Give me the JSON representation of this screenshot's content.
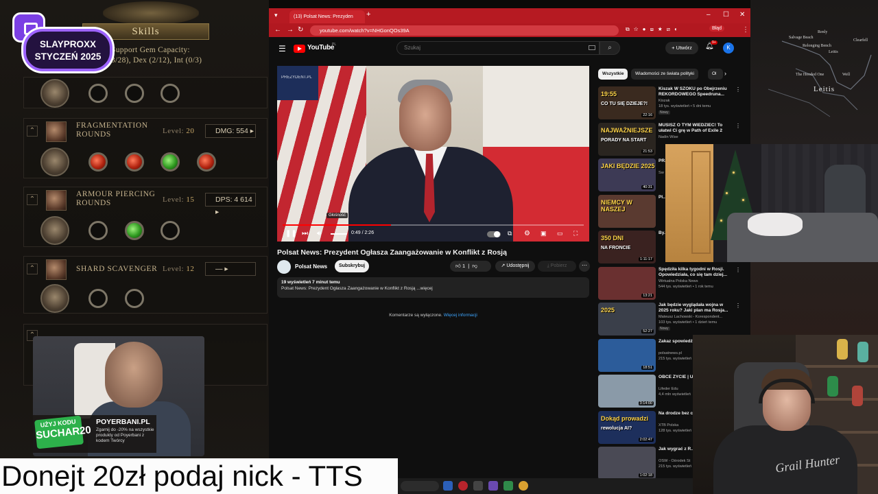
{
  "game": {
    "skills_title": "Skills",
    "support_capacity_line1": "Support Gem Capacity:",
    "support_capacity_line2": "3/28), Dex (2/12), Int (0/3)",
    "skills": [
      {
        "name": "Fragmentation Rounds",
        "level_label": "Level:",
        "level": "20",
        "stat": "DMG: 554"
      },
      {
        "name": "Armour Piercing Rounds",
        "level_label": "Level:",
        "level": "15",
        "stat": "DPS: 4 614"
      },
      {
        "name": "Shard Scavenger",
        "level_label": "Level:",
        "level": "12",
        "stat": "—"
      }
    ],
    "map_labels": [
      "Salvage Beach",
      "Renly",
      "Relonging Bench",
      "Leitis",
      "The Hooded One",
      "Well",
      "Clearfell"
    ],
    "zone": "Leitis"
  },
  "streamer_badge": {
    "line1": "SLAYPROXX",
    "line2": "STYCZEŃ 2025"
  },
  "promo": {
    "code_top": "UŻYJ KODU",
    "code": "SUCHAR20",
    "brand": "POYERBANI.PL",
    "text": "Zgarnij do -20% na wszystkie produkty od Poyerbani z kodem Twórcy"
  },
  "browser": {
    "tab_title": "(13) Polsat News: Prezyden",
    "url": "youtube.com/watch?v=NHGonQOs39A",
    "profile_label": "Błąd"
  },
  "youtube": {
    "logo_text": "YouTube",
    "logo_region": "PL",
    "search_placeholder": "Szukaj",
    "create_label": "+ Utwórz",
    "notification_count": "9+",
    "avatar_letter": "K",
    "video": {
      "watermark": "PREZYDENT.PL",
      "volume_tooltip": "Głośność",
      "time": "0:49 / 2:26",
      "progress": 0.36,
      "title": "Polsat News: Prezydent Ogłasza Zaangażowanie w Konflikt z Rosją",
      "channel": "Polsat News",
      "subscribe": "Subskrybuj",
      "likes": "1",
      "share": "Udostępnij",
      "download": "Pobierz",
      "views_meta": "19 wyświetleń  7 minut temu",
      "description": "Polsat News: Prezydent Ogłasza Zaangażowanie w Konflikt z Rosją ...więcej",
      "comments_off": "Komentarze są wyłączone.",
      "comments_link": "Więcej informacji"
    },
    "chips": [
      "Wszystkie",
      "Wiadomości ze świata polityki",
      "Ol"
    ],
    "recommendations": [
      {
        "title": "Kiszak W SZOKU po Obejrzeniu REKORDOWEGO Speedruna...",
        "channel": "Kiszak",
        "views": "18 tys. wyświetleń • 5 dni temu",
        "badge": "Nowy",
        "duration": "22:16",
        "caption": "19:55",
        "caption2": "CO TU SIĘ DZIEJE?!",
        "thumb": "#3a2a1f"
      },
      {
        "title": "MUSISZ O TYM WIEDZIEĆ! To ułatwi Ci grę w Path of Exile 2",
        "channel": "Nadin Wise",
        "views": "",
        "badge": "",
        "duration": "21:53",
        "caption": "NAJWAŻNIEJSZE",
        "caption2": "PORADY NA START",
        "thumb": "#2a2520"
      },
      {
        "title": "PR...",
        "channel": "Sw",
        "views": "",
        "badge": "",
        "duration": "40:31",
        "caption": "JAKI BĘDZIE 2025",
        "caption2": "",
        "thumb": "#3d3a55"
      },
      {
        "title": "Pl...",
        "channel": "",
        "views": "",
        "badge": "",
        "duration": "",
        "caption": "NIEMCY W NASZEJ",
        "caption2": "",
        "thumb": "#5a3a30"
      },
      {
        "title": "By...",
        "channel": "",
        "views": "",
        "badge": "",
        "duration": "1:11:17",
        "caption": "350 DNI",
        "caption2": "NA FRONCIE",
        "thumb": "#3a2220"
      },
      {
        "title": "Spędziła kilka tygodni w Rosji. Opowiedziała, co się tam dziej...",
        "channel": "Wirtualna Polska News",
        "views": "544 tys. wyświetleń • 1 rok temu",
        "badge": "",
        "duration": "13:21",
        "caption": "",
        "caption2": "",
        "thumb": "#6a3030"
      },
      {
        "title": "Jak będzie wyglądała wojna w 2025 roku? Jaki plan ma Rosja...",
        "channel": "Mateusz Lachowski - Korespondent...",
        "views": "103 tys. wyświetleń • 1 dzień temu",
        "badge": "Nowy",
        "duration": "52:27",
        "caption": "2025",
        "caption2": "",
        "thumb": "#3a3f4a"
      },
      {
        "title": "Zakaz spowiedź Arcybiskup: Ab...",
        "channel": "polsatnews.pl",
        "views": "215 tys. wyświetleń",
        "badge": "",
        "duration": "18:51",
        "caption": "",
        "caption2": "",
        "thumb": "#2c5c9a"
      },
      {
        "title": "OBCE ŻYCIE | U paradoks Fermi...",
        "channel": "Lifeder Edu",
        "views": "4,4 mln wyświetleń",
        "badge": "",
        "duration": "3:14:00",
        "caption": "",
        "caption2": "",
        "thumb": "#8a9aa8"
      },
      {
        "title": "Na drodze bez c prowadzi nas re...",
        "channel": "XTB Polska",
        "views": "128 tys. wyświetleń",
        "badge": "",
        "duration": "2:02:47",
        "caption": "Dokąd prowadzi",
        "caption2": "rewolucja AI?",
        "thumb": "#1d2f5c"
      },
      {
        "title": "Jak wygrać z R...",
        "channel": "OSW - Ośrodek St",
        "views": "215 tys. wyświetleń",
        "badge": "",
        "duration": "1:02:18",
        "caption": "",
        "caption2": "",
        "thumb": "#4a4a55"
      }
    ]
  },
  "shirt_print": "Grail Hunter",
  "tts_banner": "Donejt 20zł podaj nick - TTS",
  "colors": {
    "youtube_red": "#ff0000",
    "browser_red": "#b61a22",
    "game_gold": "#c9a96a",
    "badge_purple": "#9d63ff"
  }
}
